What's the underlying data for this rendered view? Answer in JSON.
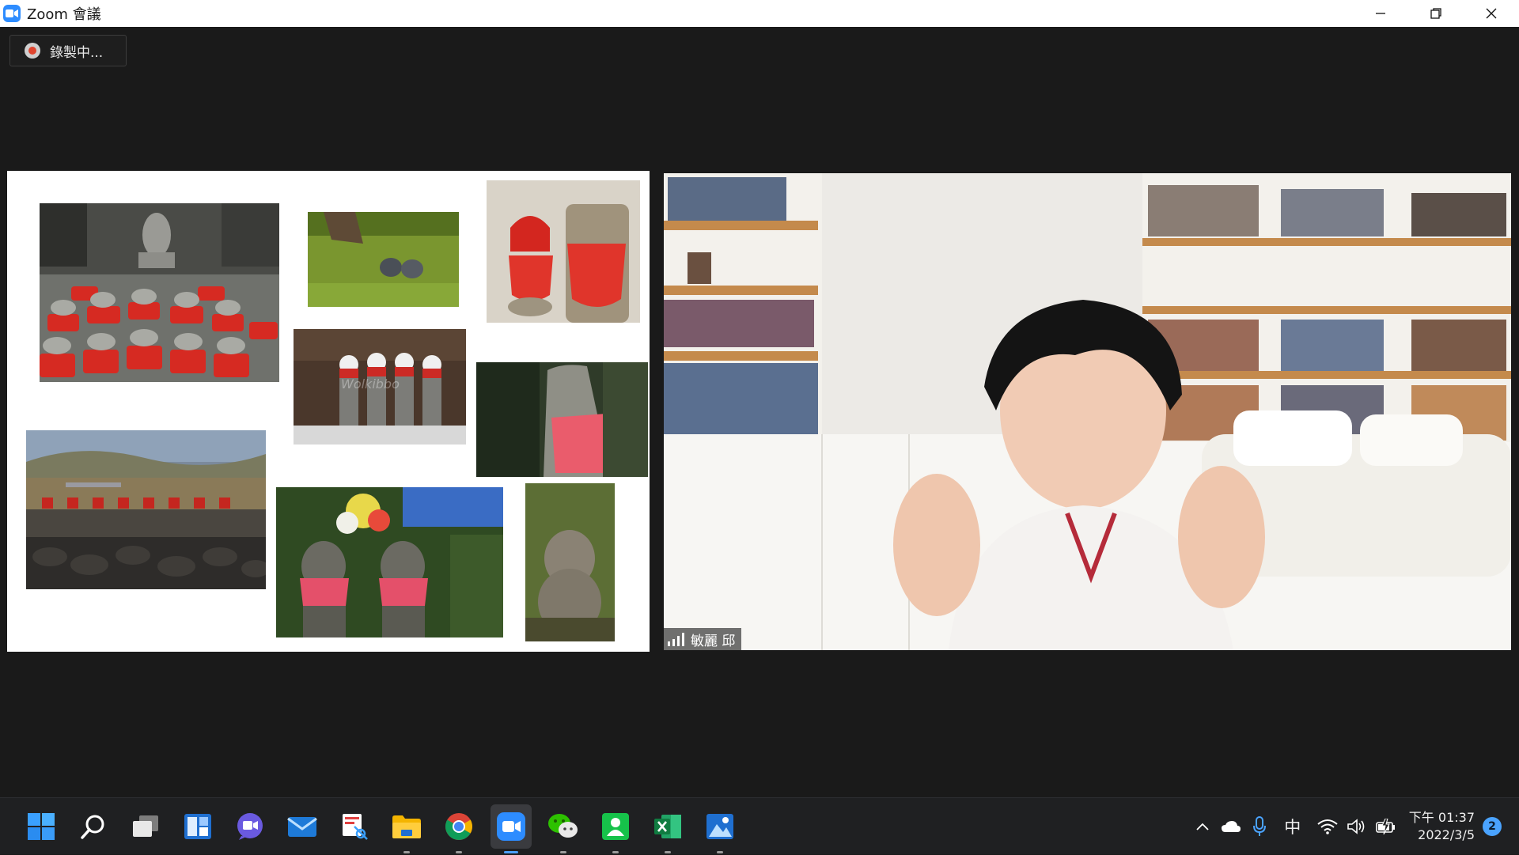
{
  "window": {
    "title": "Zoom 會議",
    "icon": "zoom-camera-icon",
    "controls": [
      "minimize-icon",
      "restore-icon",
      "close-icon"
    ]
  },
  "recording": {
    "label": "錄製中..."
  },
  "slide": {
    "watermark": "Wolkibbo",
    "photos": [
      "jizo-statues-red-bibs-temple",
      "two-stones-moss",
      "jizo-red-caps-bibs",
      "snow-covered-jizo-row",
      "stone-jizo-red-apron-forest",
      "jizo-row-stone-wall-field",
      "jizo-pink-bibs-flowers",
      "round-stone-jizo"
    ]
  },
  "participant": {
    "name": "敏麗 邱",
    "signal_icon": "signal-bars-icon"
  },
  "taskbar": {
    "apps": [
      {
        "name": "start",
        "icon": "windows-start-icon",
        "running": false,
        "active": false
      },
      {
        "name": "search",
        "icon": "search-icon",
        "running": false,
        "active": false
      },
      {
        "name": "task-view",
        "icon": "task-view-icon",
        "running": false,
        "active": false
      },
      {
        "name": "widgets",
        "icon": "widgets-icon",
        "running": false,
        "active": false
      },
      {
        "name": "chat",
        "icon": "teams-chat-icon",
        "running": false,
        "active": false
      },
      {
        "name": "mail",
        "icon": "mail-icon",
        "running": false,
        "active": false
      },
      {
        "name": "snipping",
        "icon": "snipping-tool-icon",
        "running": false,
        "active": false
      },
      {
        "name": "explorer",
        "icon": "folder-icon",
        "running": true,
        "active": false
      },
      {
        "name": "chrome",
        "icon": "chrome-icon",
        "running": true,
        "active": false
      },
      {
        "name": "zoom",
        "icon": "zoom-camera-icon",
        "running": true,
        "active": true
      },
      {
        "name": "wechat",
        "icon": "wechat-icon",
        "running": true,
        "active": false
      },
      {
        "name": "line",
        "icon": "person-app-icon",
        "running": true,
        "active": false
      },
      {
        "name": "excel",
        "icon": "excel-icon",
        "running": true,
        "active": false
      },
      {
        "name": "photos",
        "icon": "photos-icon",
        "running": true,
        "active": false
      }
    ],
    "tray": {
      "ime": "中",
      "time": "下午 01:37",
      "date": "2022/3/5",
      "notifications": "2"
    }
  }
}
